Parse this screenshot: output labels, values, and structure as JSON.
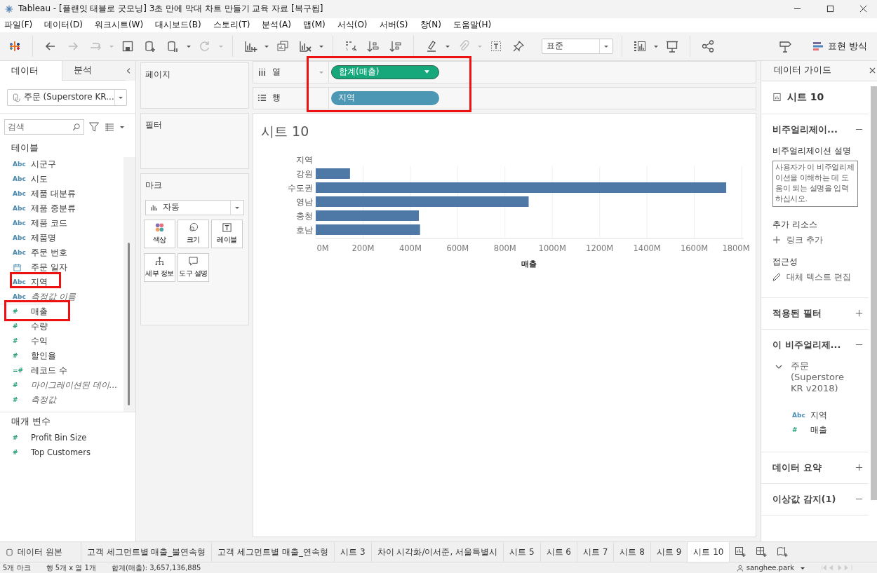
{
  "window": {
    "title": "Tableau - [플랜잇 태블로 굿모닝] 3초 만에 막대 차트 만들기 교육 자료 [복구됨]"
  },
  "menu": [
    "파일(F)",
    "데이터(D)",
    "워크시트(W)",
    "대시보드(B)",
    "스토리(T)",
    "분석(A)",
    "맵(M)",
    "서식(O)",
    "서버(S)",
    "창(N)",
    "도움말(H)"
  ],
  "toolbar": {
    "fit": "표준",
    "show_me": "표현 방식"
  },
  "data_pane": {
    "tabs": [
      {
        "label": "데이터",
        "selected": true
      },
      {
        "label": "분석",
        "selected": false
      }
    ],
    "datasource": "주문 (Superstore KR...",
    "search": {
      "placeholder": "검색"
    },
    "tables_heading": "테이블",
    "fields": [
      {
        "name": "시군구",
        "kind": "text",
        "type_icon": "Abc",
        "italic": false
      },
      {
        "name": "시도",
        "kind": "text",
        "type_icon": "Abc",
        "italic": false
      },
      {
        "name": "제품 대분류",
        "kind": "text",
        "type_icon": "Abc",
        "italic": false
      },
      {
        "name": "제품 중분류",
        "kind": "text",
        "type_icon": "Abc",
        "italic": false
      },
      {
        "name": "제품 코드",
        "kind": "text",
        "type_icon": "Abc",
        "italic": false
      },
      {
        "name": "제품명",
        "kind": "text",
        "type_icon": "Abc",
        "italic": false
      },
      {
        "name": "주문 번호",
        "kind": "text",
        "type_icon": "Abc",
        "italic": false
      },
      {
        "name": "주문 일자",
        "kind": "date",
        "italic": false
      },
      {
        "name": "지역",
        "kind": "text",
        "type_icon": "Abc",
        "italic": false
      },
      {
        "name": "측정값 이름",
        "kind": "text",
        "type_icon": "Abc",
        "italic": true
      },
      {
        "name": "매출",
        "kind": "number",
        "type_icon": "#",
        "italic": false
      },
      {
        "name": "수량",
        "kind": "number",
        "type_icon": "#",
        "italic": false
      },
      {
        "name": "수익",
        "kind": "number",
        "type_icon": "#",
        "italic": false
      },
      {
        "name": "할인율",
        "kind": "number",
        "type_icon": "#",
        "italic": false
      },
      {
        "name": "레코드 수",
        "kind": "number",
        "type_icon": "=#",
        "italic": false
      },
      {
        "name": "마이그레이션된 데이...",
        "kind": "number",
        "type_icon": "#",
        "italic": true
      },
      {
        "name": "측정값",
        "kind": "number",
        "type_icon": "#",
        "italic": true
      }
    ],
    "parameters_heading": "매개 변수",
    "parameters": [
      {
        "name": "Profit Bin Size",
        "type_icon": "#"
      },
      {
        "name": "Top Customers",
        "type_icon": "#"
      }
    ]
  },
  "cards": {
    "pages": "페이지",
    "filters": "필터",
    "marks": {
      "title": "마크",
      "mark_type": "자동",
      "buttons": [
        {
          "label": "색상",
          "kind": "color"
        },
        {
          "label": "크기",
          "kind": "size"
        },
        {
          "label": "레이블",
          "kind": "label"
        },
        {
          "label": "세부 정보",
          "kind": "detail"
        },
        {
          "label": "도구 설명",
          "kind": "tooltip"
        }
      ]
    }
  },
  "shelves": {
    "columns": {
      "label": "열",
      "pills": [
        {
          "label": "합계(매출)",
          "kind": "measure"
        }
      ]
    },
    "rows": {
      "label": "행",
      "pills": [
        {
          "label": "지역",
          "kind": "dimension"
        }
      ]
    }
  },
  "viz": {
    "title": "시트 10",
    "row_header": "지역",
    "chart_data": {
      "type": "bar",
      "orientation": "horizontal",
      "xlabel": "매출",
      "categories": [
        "강원",
        "수도권",
        "영남",
        "충청",
        "호남"
      ],
      "series": [
        {
          "color": "#4e79a7",
          "values": [
            145,
            1735,
            900,
            436,
            441
          ]
        }
      ],
      "grid": true,
      "xlim": [
        0,
        1800
      ],
      "xticks": [
        {
          "value": 0,
          "label": "0M"
        },
        {
          "value": 200,
          "label": "200M"
        },
        {
          "value": 400,
          "label": "400M"
        },
        {
          "value": 600,
          "label": "600M"
        },
        {
          "value": 800,
          "label": "800M"
        },
        {
          "value": 1000,
          "label": "1000M"
        },
        {
          "value": 1200,
          "label": "1200M"
        },
        {
          "value": 1400,
          "label": "1400M"
        },
        {
          "value": 1600,
          "label": "1600M"
        },
        {
          "value": 1800,
          "label": "1800M"
        }
      ]
    }
  },
  "guide": {
    "title": "데이터 가이드",
    "sheet": "시트 10",
    "sections": [
      {
        "kind": "description",
        "title": "비주얼리제이...",
        "expanded": true,
        "label": "비주얼리제이션 설명",
        "placeholder": "사용자가 이 비주얼리제이션을 이해하는 데 도움이 되는 설명을 입력하십시오.",
        "resources_label": "추가 리소스",
        "add_link": "링크 추가",
        "accessibility_label": "접근성",
        "alt_text": "대체 텍스트 편집"
      },
      {
        "kind": "filters",
        "title": "적용된 필터",
        "expanded": false
      },
      {
        "kind": "fields",
        "title": "이 비주얼리제...",
        "expanded": true,
        "source": "주문 (Superstore KR v2018)",
        "fields": [
          {
            "name": "지역",
            "type_icon": "Abc",
            "kind": "text"
          },
          {
            "name": "매출",
            "type_icon": "#",
            "kind": "number"
          }
        ]
      },
      {
        "kind": "summary",
        "title": "데이터 요약",
        "expanded": false
      },
      {
        "kind": "outliers",
        "title": "이상값 감지(1)",
        "expanded": true
      }
    ]
  },
  "sheet_tabs": [
    {
      "label": "데이터 원본",
      "kind": "datasource",
      "selected": false
    },
    {
      "label": "고객 세그먼트별 매출_불연속형",
      "kind": "sheet",
      "selected": false
    },
    {
      "label": "고객 세그먼트별 매출_연속형",
      "kind": "sheet",
      "selected": false
    },
    {
      "label": "시트 3",
      "kind": "sheet",
      "selected": false
    },
    {
      "label": "차이 시각화/이서준, 서울특별시",
      "kind": "sheet",
      "selected": false
    },
    {
      "label": "시트 5",
      "kind": "sheet",
      "selected": false
    },
    {
      "label": "시트 6",
      "kind": "sheet",
      "selected": false
    },
    {
      "label": "시트 7",
      "kind": "sheet",
      "selected": false
    },
    {
      "label": "시트 8",
      "kind": "sheet",
      "selected": false
    },
    {
      "label": "시트 9",
      "kind": "sheet",
      "selected": false
    },
    {
      "label": "시트 10",
      "kind": "sheet",
      "selected": true
    }
  ],
  "status_bar": {
    "marks": "5개 마크",
    "dims": "행 5개 x 열 1개",
    "sum": "합계(매출): 3,657,136,885",
    "user": "sanghee.park"
  }
}
